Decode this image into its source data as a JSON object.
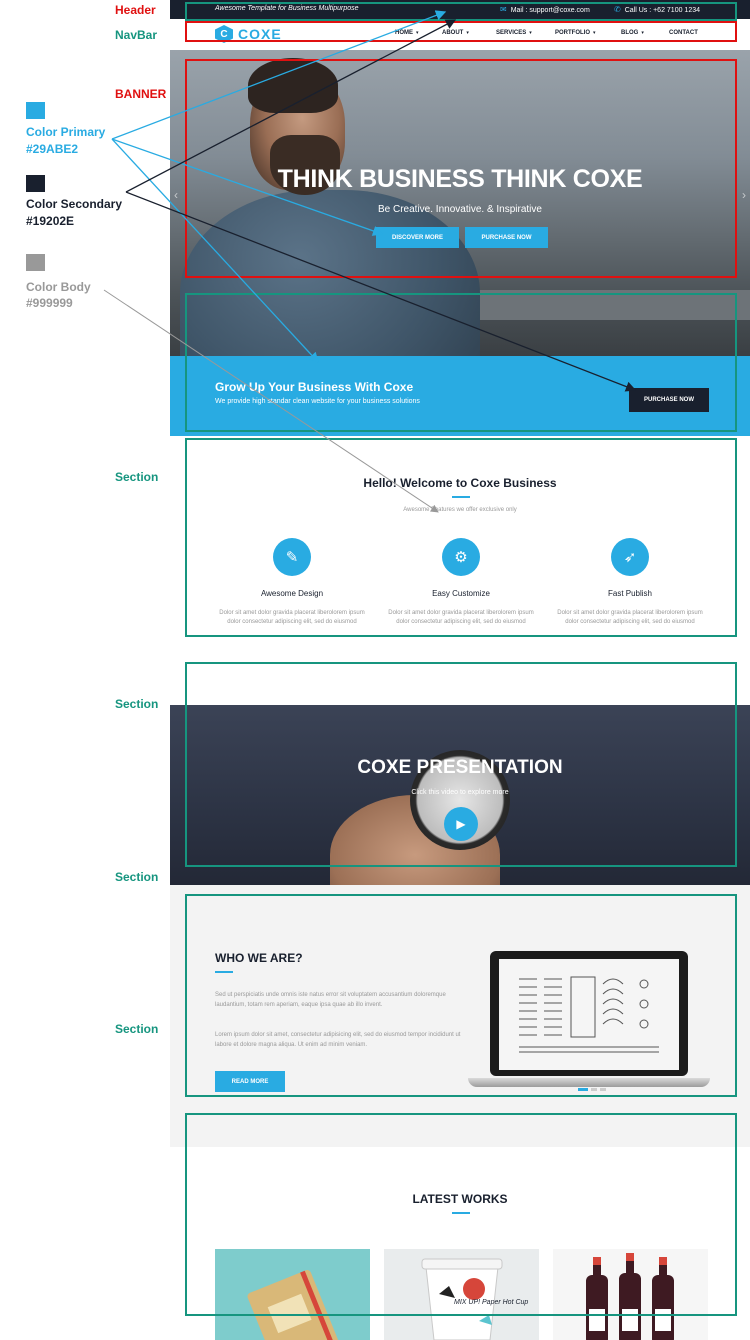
{
  "annotations": {
    "header": "Header",
    "navbar": "NavBar",
    "banner": "BANNER",
    "section_1": "Section",
    "section_2": "Section",
    "section_3": "Section",
    "section_4": "Section"
  },
  "colors": {
    "primary": {
      "name": "Color Primary",
      "hex": "#29ABE2"
    },
    "secondary": {
      "name": "Color Secondary",
      "hex": "#19202E"
    },
    "body": {
      "name": "Color Body",
      "hex": "#999999"
    }
  },
  "topbar": {
    "tagline": "Awesome Template for Business Multipurpose",
    "mail": "Mail : support@coxe.com",
    "call": "Call Us : +62 7100 1234",
    "mail_icon": "envelope-icon",
    "call_icon": "phone-icon"
  },
  "navbar": {
    "logo_text": "COXE",
    "items": [
      {
        "label": "HOME",
        "dropdown": true
      },
      {
        "label": "ABOUT",
        "dropdown": true
      },
      {
        "label": "SERVICES",
        "dropdown": true
      },
      {
        "label": "PORTFOLIO",
        "dropdown": true
      },
      {
        "label": "BLOG",
        "dropdown": true
      },
      {
        "label": "CONTACT",
        "dropdown": false
      }
    ]
  },
  "banner": {
    "title": "THINK BUSINESS THINK COXE",
    "subtitle": "Be Creative. Innovative. & Inspirative",
    "primary_button": "DISCOVER MORE",
    "secondary_button": "PURCHASE NOW"
  },
  "cta": {
    "title": "Grow Up Your Business With Coxe",
    "subtitle": "We provide high standar clean website for your business solutions",
    "button": "PURCHASE NOW"
  },
  "welcome": {
    "title": "Hello! Welcome to Coxe Business",
    "subtitle": "Awesome Features we offer exclusive only",
    "features": [
      {
        "icon": "brush-icon",
        "title": "Awesome Design",
        "text": "Dolor sit amet dolor gravida placerat liberolorem ipsum dolor consectetur adipiscing elit, sed do eiusmod"
      },
      {
        "icon": "gears-icon",
        "title": "Easy Customize",
        "text": "Dolor sit amet dolor gravida placerat liberolorem ipsum dolor consectetur adipiscing elit, sed do eiusmod"
      },
      {
        "icon": "rocket-icon",
        "title": "Fast Publish",
        "text": "Dolor sit amet dolor gravida placerat liberolorem ipsum dolor consectetur adipiscing elit, sed do eiusmod"
      }
    ]
  },
  "presentation": {
    "title": "COXE PRESENTATION",
    "subtitle": "Click this video to explore more"
  },
  "who": {
    "title": "WHO WE ARE?",
    "paragraph_1": "Sed ut perspiciatis unde omnis iste natus error sit voluptatem accusantium doloremque laudantium, totam rem aperiam, eaque ipsa quae ab illo invent.",
    "paragraph_2": "Lorem ipsum dolor sit amet, consectetur adipisicing elit, sed do eiusmod tempor incididunt ut labore et dolore magna aliqua. Ut enim ad minim veniam.",
    "button": "READ MORE"
  },
  "works": {
    "title": "LATEST WORKS",
    "cup_text": "MIX UP! Paper Hot Cup"
  }
}
